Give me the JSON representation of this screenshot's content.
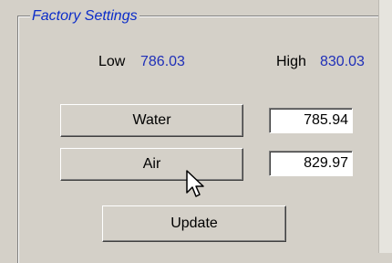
{
  "group": {
    "title": "Factory Settings"
  },
  "range": {
    "low_label": "Low",
    "low_value": "786.03",
    "high_label": "High",
    "high_value": "830.03"
  },
  "buttons": {
    "water_label": "Water",
    "air_label": "Air",
    "update_label": "Update"
  },
  "fields": {
    "water_value": "785.94",
    "air_value": "829.97"
  },
  "cursor": {
    "icon": "mouse-pointer-arrow-icon"
  },
  "colors": {
    "background": "#d4d0c8",
    "title_text": "#0b2cc9",
    "value_text": "#1f2fb8"
  }
}
